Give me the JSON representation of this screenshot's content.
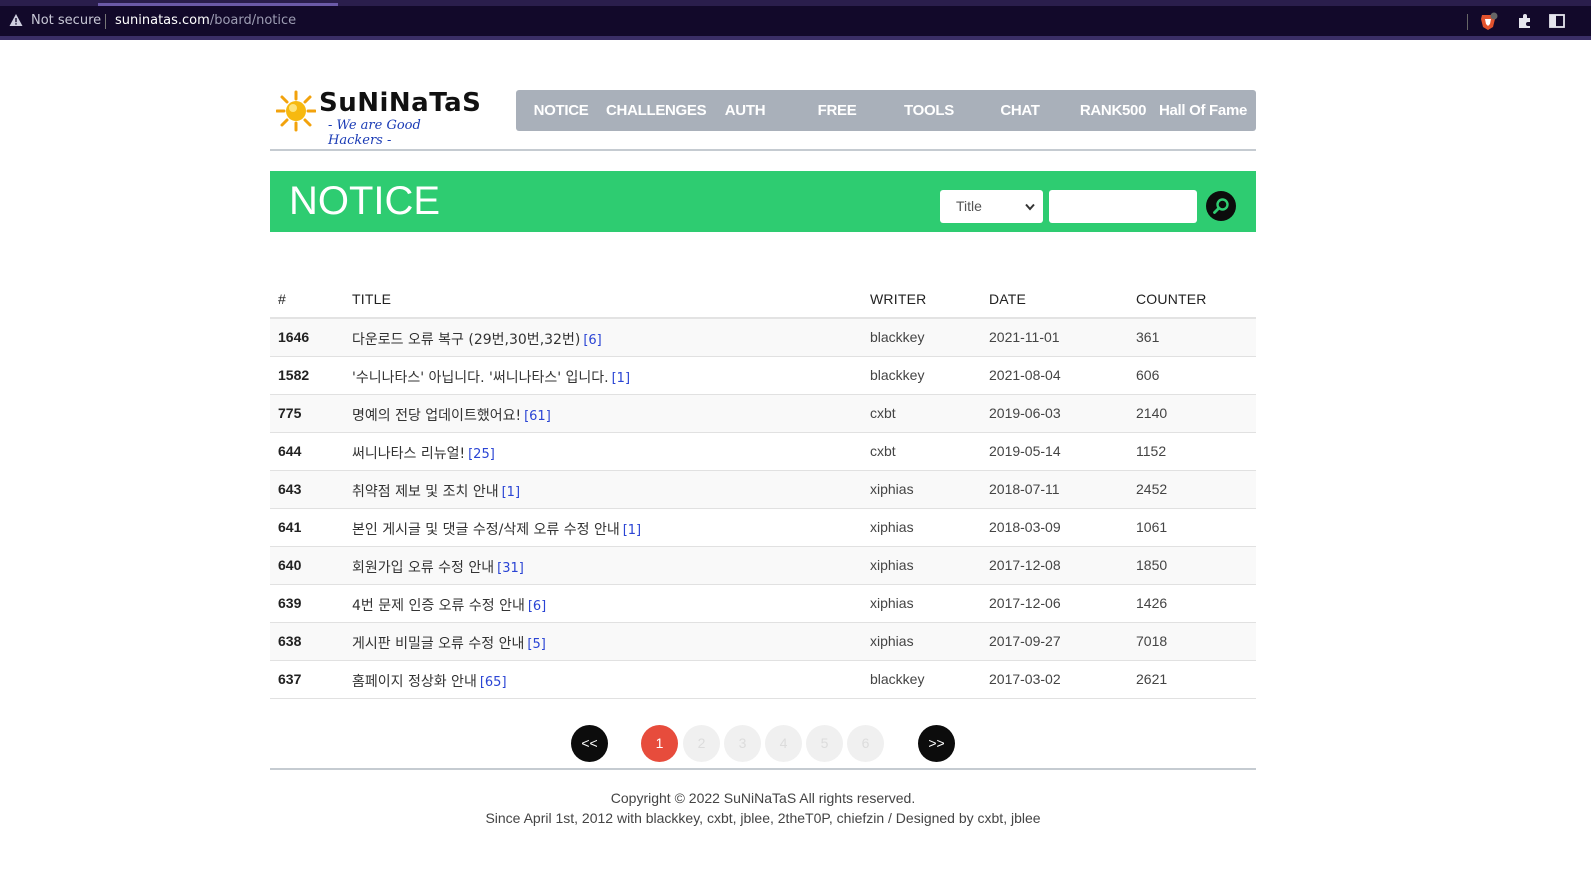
{
  "browser": {
    "security_label": "Not secure",
    "url_domain": "suninatas.com",
    "url_path": "/board/notice",
    "icons": [
      "warning-triangle-icon",
      "brave-shield-icon",
      "extensions-puzzle-icon",
      "sidebar-panel-icon"
    ]
  },
  "site": {
    "logo_title": "SuNiNaTaS",
    "logo_subtitle": "- We are Good Hackers -"
  },
  "nav": {
    "items": [
      "NOTICE",
      "CHALLENGES",
      "AUTH",
      "FREE",
      "TOOLS",
      "CHAT",
      "RANK500",
      "Hall Of Fame"
    ]
  },
  "board": {
    "title": "NOTICE",
    "search_select": "Title",
    "search_value": "",
    "search_icon": "search-icon",
    "colors": {
      "banner": "#2ecc71",
      "nav": "#a9b0ba",
      "active_page": "#e74c3c"
    }
  },
  "table": {
    "headers": [
      "#",
      "TITLE",
      "WRITER",
      "DATE",
      "COUNTER"
    ],
    "rows": [
      {
        "num": "1646",
        "title": "다운로드 오류 복구 (29번,30번,32번)",
        "comments": "[6]",
        "writer": "blackkey",
        "date": "2021-11-01",
        "counter": "361"
      },
      {
        "num": "1582",
        "title": "'수니나타스' 아닙니다. '써니나타스' 입니다.",
        "comments": "[1]",
        "writer": "blackkey",
        "date": "2021-08-04",
        "counter": "606"
      },
      {
        "num": "775",
        "title": "명예의 전당 업데이트했어요!",
        "comments": "[61]",
        "writer": "cxbt",
        "date": "2019-06-03",
        "counter": "2140"
      },
      {
        "num": "644",
        "title": "써니나타스 리뉴얼!",
        "comments": "[25]",
        "writer": "cxbt",
        "date": "2019-05-14",
        "counter": "1152"
      },
      {
        "num": "643",
        "title": "취약점 제보 및 조치 안내",
        "comments": "[1]",
        "writer": "xiphias",
        "date": "2018-07-11",
        "counter": "2452"
      },
      {
        "num": "641",
        "title": "본인 게시글 및 댓글 수정/삭제 오류 수정 안내",
        "comments": "[1]",
        "writer": "xiphias",
        "date": "2018-03-09",
        "counter": "1061"
      },
      {
        "num": "640",
        "title": "회원가입 오류 수정 안내",
        "comments": "[31]",
        "writer": "xiphias",
        "date": "2017-12-08",
        "counter": "1850"
      },
      {
        "num": "639",
        "title": "4번 문제 인증 오류 수정 안내",
        "comments": "[6]",
        "writer": "xiphias",
        "date": "2017-12-06",
        "counter": "1426"
      },
      {
        "num": "638",
        "title": "게시판 비밀글 오류 수정 안내",
        "comments": "[5]",
        "writer": "xiphias",
        "date": "2017-09-27",
        "counter": "7018"
      },
      {
        "num": "637",
        "title": "홈페이지 정상화 안내",
        "comments": "[65]",
        "writer": "blackkey",
        "date": "2017-03-02",
        "counter": "2621"
      }
    ]
  },
  "pagination": {
    "prev": "<<",
    "next": ">>",
    "pages": [
      "1",
      "2",
      "3",
      "4",
      "5",
      "6"
    ],
    "current": "1"
  },
  "footer": {
    "line1": "Copyright © 2022 SuNiNaTaS All rights reserved.",
    "line2": "Since April 1st, 2012 with blackkey, cxbt, jblee, 2theT0P, chiefzin / Designed by cxbt, jblee"
  }
}
